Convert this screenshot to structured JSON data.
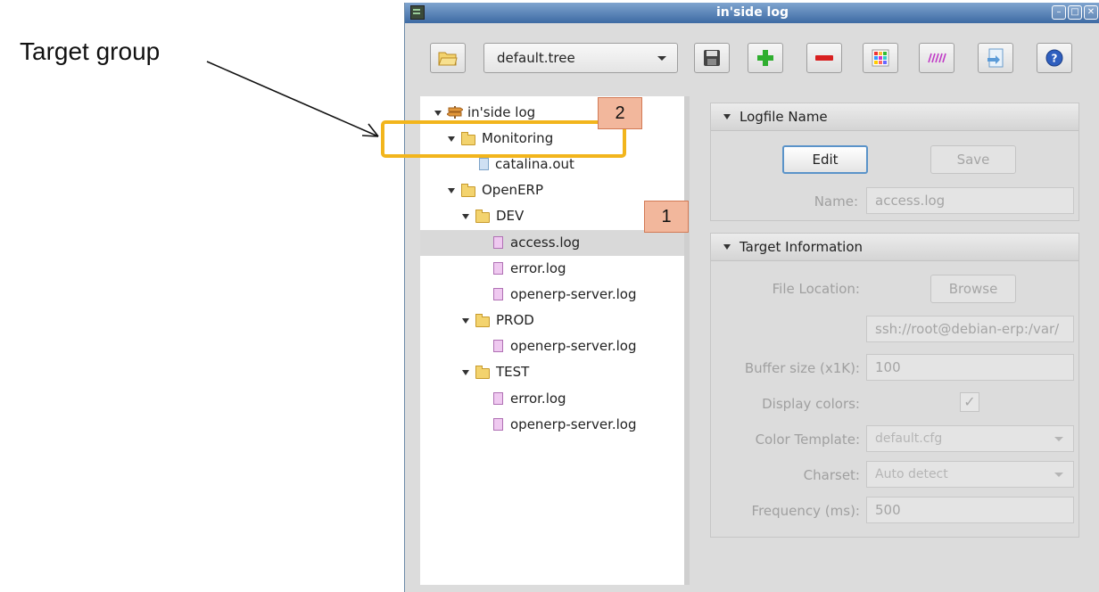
{
  "annotation": {
    "label": "Target group",
    "badge_1": "1",
    "badge_2": "2",
    "highlight_color": "#f2b51c",
    "badge_color": "#f2b79c"
  },
  "window": {
    "title": "in'side log",
    "controls": [
      "minimize-icon",
      "maximize-icon",
      "close-icon"
    ]
  },
  "toolbar": {
    "open_icon": "folder-open-icon",
    "tree_select_value": "default.tree",
    "buttons": [
      "save-icon",
      "add-icon",
      "remove-icon",
      "colors-icon",
      "pattern-icon",
      "export-icon",
      "help-icon"
    ]
  },
  "tree": {
    "root": "in'side log",
    "monitoring": "Monitoring",
    "catalina": "catalina.out",
    "openerp": "OpenERP",
    "dev": "DEV",
    "dev_access": "access.log",
    "dev_error": "error.log",
    "dev_server": "openerp-server.log",
    "prod": "PROD",
    "prod_server": "openerp-server.log",
    "test": "TEST",
    "test_error": "error.log",
    "test_server": "openerp-server.log"
  },
  "logfile_section": {
    "title": "Logfile Name",
    "edit_label": "Edit",
    "save_label": "Save",
    "name_label": "Name:",
    "name_value": "access.log"
  },
  "target_section": {
    "title": "Target Information",
    "file_location_label": "File Location:",
    "browse_label": "Browse",
    "file_location_value": "ssh://root@debian-erp:/var/",
    "buffer_label": "Buffer size (x1K):",
    "buffer_value": "100",
    "display_colors_label": "Display colors:",
    "display_colors_checked": "✓",
    "color_template_label": "Color Template:",
    "color_template_value": "default.cfg",
    "charset_label": "Charset:",
    "charset_value": "Auto detect",
    "frequency_label": "Frequency (ms):",
    "frequency_value": "500"
  }
}
